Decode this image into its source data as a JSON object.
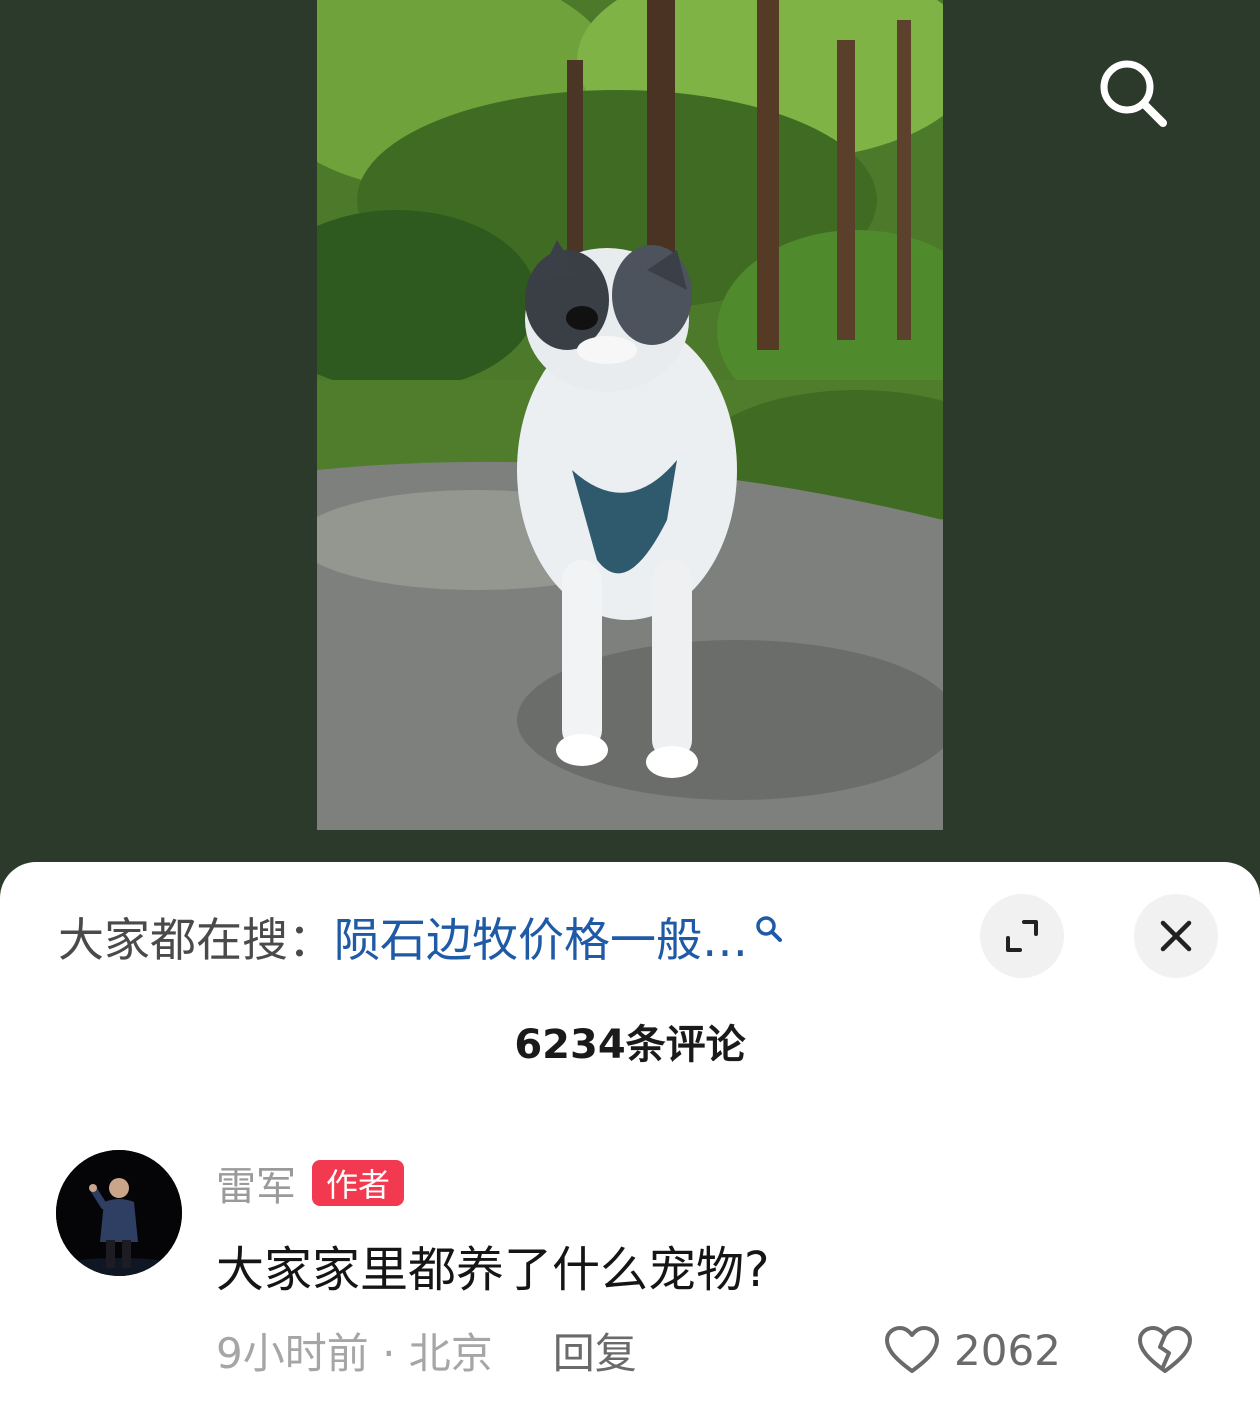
{
  "hot_search": {
    "prefix": "大家都在搜：",
    "query": "陨石边牧价格一般…"
  },
  "comments_header": {
    "count_label": "6234条评论"
  },
  "comment": {
    "author": "雷军",
    "badge": "作者",
    "text": "大家家里都养了什么宠物?",
    "time_location": "9小时前 · 北京",
    "reply_label": "回复",
    "like_count": "2062"
  },
  "icons": {
    "search": "search-icon",
    "expand": "expand-icon",
    "close": "close-icon",
    "like": "heart-icon",
    "dislike": "broken-heart-icon"
  },
  "colors": {
    "media_background": "#2b3a2b",
    "query_link": "#1f5aa6",
    "author_badge": "#f2394f"
  }
}
